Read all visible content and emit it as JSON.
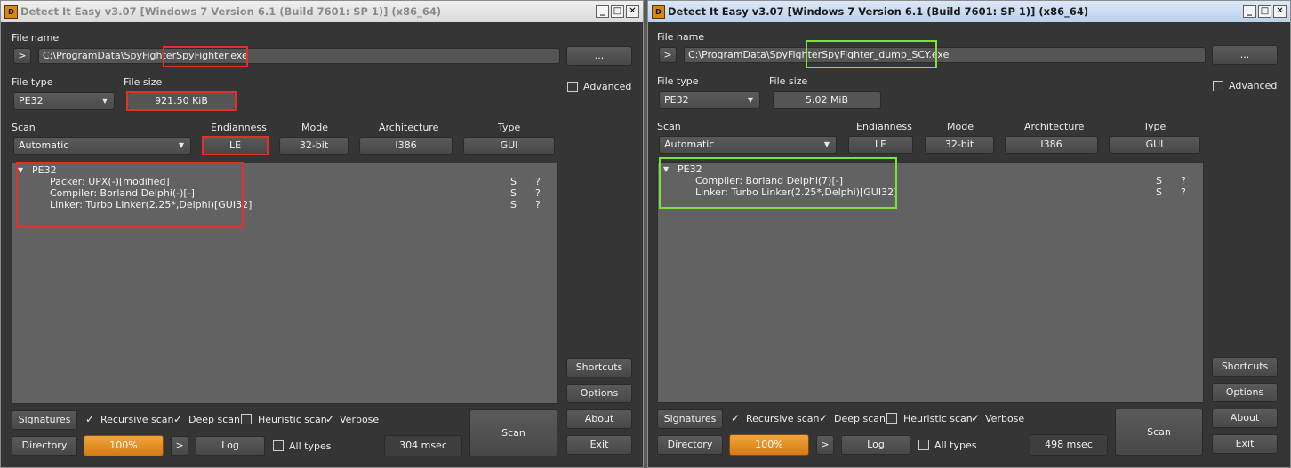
{
  "colors": {
    "highlight_left": "#e3302c",
    "highlight_right": "#7be042",
    "orange": "#e08a20"
  },
  "left": {
    "title": "Detect It Easy v3.07 [Windows 7 Version 6.1 (Build 7601: SP 1)] (x86_64)",
    "file_name_label": "File name",
    "path_prefix": "C:\\ProgramData\\SpyFighter",
    "path_file": "SpyFighter.exe",
    "browse_label": "...",
    "advanced_label": "Advanced",
    "file_type_label": "File type",
    "file_type_value": "PE32",
    "file_size_label": "File size",
    "file_size_value": "921.50 KiB",
    "scan_label": "Scan",
    "scan_value": "Automatic",
    "endianness_label": "Endianness",
    "endianness_value": "LE",
    "mode_label": "Mode",
    "mode_value": "32-bit",
    "arch_label": "Architecture",
    "arch_value": "I386",
    "type_label": "Type",
    "type_value": "GUI",
    "root": "PE32",
    "results": [
      {
        "text": "Packer: UPX(-)[modified]",
        "s": "S",
        "q": "?"
      },
      {
        "text": "Compiler: Borland Delphi(-)[-]",
        "s": "S",
        "q": "?"
      },
      {
        "text": "Linker: Turbo Linker(2.25*,Delphi)[GUI32]",
        "s": "S",
        "q": "?"
      }
    ],
    "side_buttons": [
      "Shortcuts",
      "Options",
      "About",
      "Exit"
    ],
    "signatures_label": "Signatures",
    "recursive_label": "Recursive scan",
    "deep_label": "Deep scan",
    "heuristic_label": "Heuristic scan",
    "verbose_label": "Verbose",
    "scan_button": "Scan",
    "directory_label": "Directory",
    "progress": "100%",
    "progress_fraction": 1.0,
    "arrow_label": ">",
    "log_label": "Log",
    "alltypes_label": "All types",
    "time": "304 msec"
  },
  "right": {
    "title": "Detect It Easy v3.07 [Windows 7 Version 6.1 (Build 7601: SP 1)] (x86_64)",
    "file_name_label": "File name",
    "path_prefix": "C:\\ProgramData\\SpyFighter",
    "path_file": "SpyFighter_dump_SCY.exe",
    "browse_label": "...",
    "advanced_label": "Advanced",
    "file_type_label": "File type",
    "file_type_value": "PE32",
    "file_size_label": "File size",
    "file_size_value": "5.02 MiB",
    "scan_label": "Scan",
    "scan_value": "Automatic",
    "endianness_label": "Endianness",
    "endianness_value": "LE",
    "mode_label": "Mode",
    "mode_value": "32-bit",
    "arch_label": "Architecture",
    "arch_value": "I386",
    "type_label": "Type",
    "type_value": "GUI",
    "root": "PE32",
    "results": [
      {
        "text": "Compiler: Borland Delphi(7)[-]",
        "s": "S",
        "q": "?"
      },
      {
        "text": "Linker: Turbo Linker(2.25*,Delphi)[GUI32]",
        "s": "S",
        "q": "?"
      }
    ],
    "side_buttons": [
      "Shortcuts",
      "Options",
      "About",
      "Exit"
    ],
    "signatures_label": "Signatures",
    "recursive_label": "Recursive scan",
    "deep_label": "Deep scan",
    "heuristic_label": "Heuristic scan",
    "verbose_label": "Verbose",
    "scan_button": "Scan",
    "directory_label": "Directory",
    "progress": "100%",
    "progress_fraction": 1.0,
    "arrow_label": ">",
    "log_label": "Log",
    "alltypes_label": "All types",
    "time": "498 msec"
  }
}
